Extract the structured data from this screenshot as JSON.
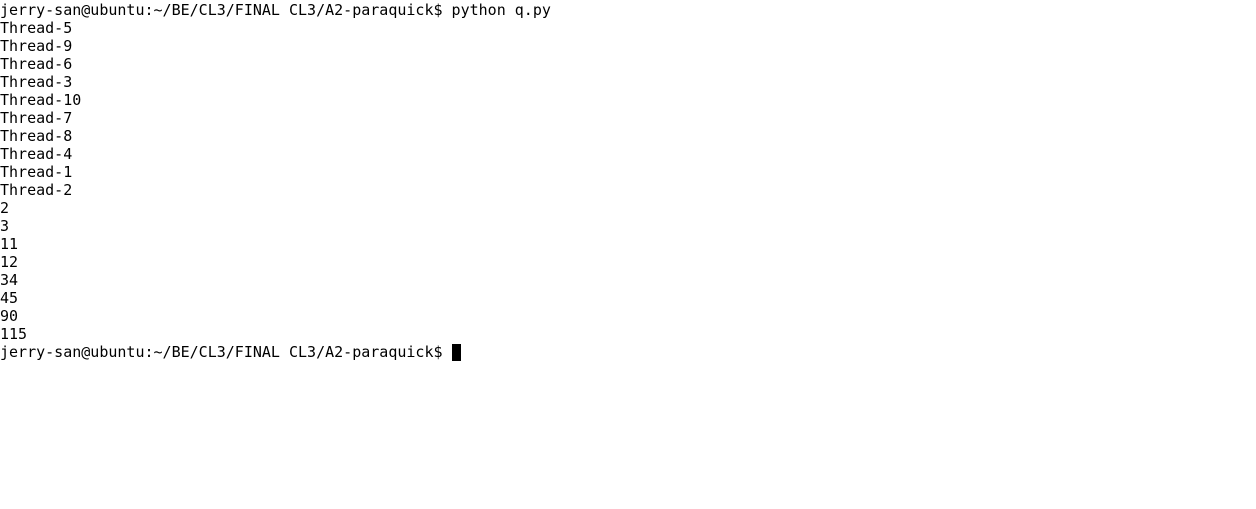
{
  "terminal": {
    "command_line": {
      "prompt": "jerry-san@ubuntu:~/BE/CL3/FINAL CL3/A2-paraquick$",
      "command": "python q.py"
    },
    "output": [
      "Thread-5",
      "Thread-9",
      "Thread-6",
      "Thread-3",
      "Thread-10",
      "Thread-7",
      "Thread-8",
      "Thread-4",
      "Thread-1",
      "Thread-2",
      "2",
      "3",
      "11",
      "12",
      "34",
      "45",
      "90",
      "115"
    ],
    "final_prompt": "jerry-san@ubuntu:~/BE/CL3/FINAL CL3/A2-paraquick$",
    "colors": {
      "background": "#ffffff",
      "text": "#000000",
      "cursor": "#000000"
    }
  }
}
